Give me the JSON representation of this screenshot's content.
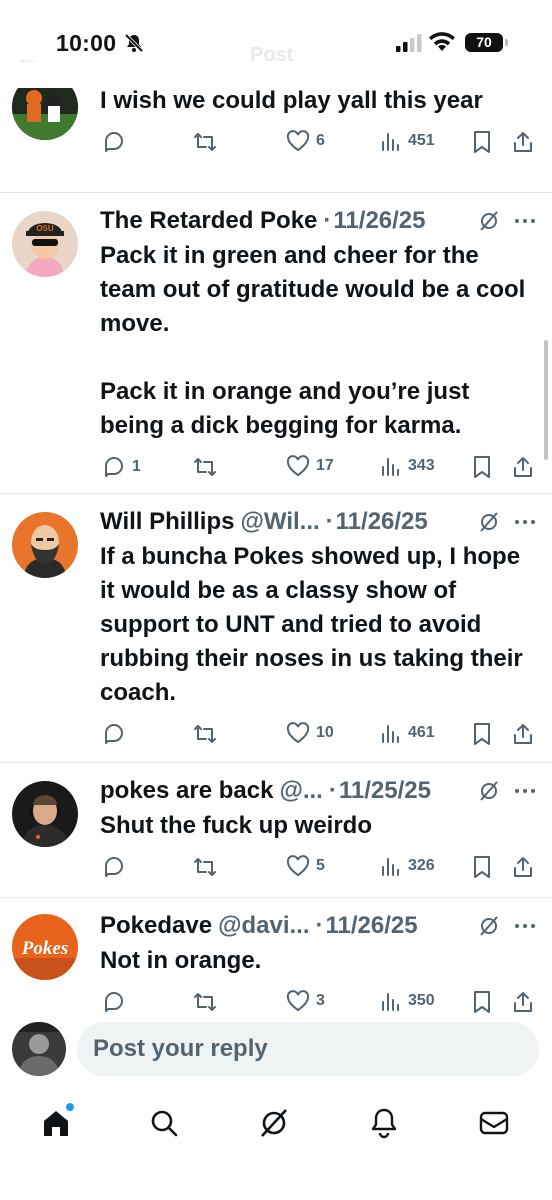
{
  "status_bar": {
    "time": "10:00",
    "battery": "70",
    "ghost_back": "←",
    "ghost_title": "Post"
  },
  "colors": {
    "accent": "#1d9bf0",
    "text": "#0f1419",
    "muted": "#536471",
    "divider": "#e6e9ec"
  },
  "top_tweet": {
    "text": "I wish we could play yall this year",
    "likes": "6",
    "views": "451"
  },
  "tweets": [
    {
      "name": "The Retarded Poke",
      "handle": "",
      "date": "11/26/25",
      "text": "Pack it in green and cheer for the team out of gratitude would be a cool move.\n\nPack it in orange and you’re just being a dick begging for karma.",
      "replies": "1",
      "reposts": "",
      "likes": "17",
      "views": "343"
    },
    {
      "name": "Will Phillips",
      "handle": "@Wil...",
      "date": "11/26/25",
      "text": "If a buncha Pokes showed up, I hope it would be as a classy show of support to UNT and tried to avoid rubbing their noses in us taking their coach.",
      "replies": "",
      "reposts": "",
      "likes": "10",
      "views": "461"
    },
    {
      "name": "pokes are back",
      "handle": "@...",
      "date": "11/25/25",
      "text": "Shut the fuck up weirdo",
      "replies": "",
      "reposts": "",
      "likes": "5",
      "views": "326"
    },
    {
      "name": "Pokedave",
      "handle": "@davi...",
      "date": "11/26/25",
      "text": "Not in orange.",
      "replies": "",
      "reposts": "",
      "likes": "3",
      "views": "350"
    }
  ],
  "avatar_text": {
    "pokes": "Pokes",
    "cap": "OSU"
  },
  "reply": {
    "placeholder": "Post your reply"
  },
  "nav": {
    "items": [
      "home-icon",
      "search-icon",
      "grok-icon",
      "notifications-icon",
      "messages-icon"
    ]
  }
}
